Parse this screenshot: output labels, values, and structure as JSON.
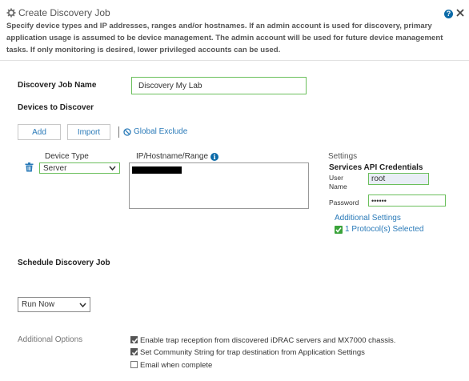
{
  "header": {
    "title": "Create Discovery Job",
    "description": "Specify device types and IP addresses, ranges and/or hostnames. If an admin account is used for discovery, primary application usage is assumed to be device management. The admin account will be used for future device management tasks. If only monitoring is desired, lower privileged accounts can be used.",
    "help_icon": "question-circle-icon",
    "help_label": "?",
    "close_icon": "close-icon"
  },
  "job": {
    "name_label": "Discovery Job Name",
    "name_value": "Discovery My Lab"
  },
  "devices": {
    "section_title": "Devices to Discover",
    "add_label": "Add",
    "import_label": "Import",
    "global_exclude_label": "Global Exclude",
    "device_type_label": "Device Type",
    "device_type_value": "Server",
    "ip_label": "IP/Hostname/Range",
    "info_glyph": "i",
    "settings_label": "Settings",
    "credentials_title": "Services API Credentials",
    "user_name_label_1": "User",
    "user_name_label_2": "Name",
    "user_name_value": "root",
    "password_label": "Password",
    "password_value": "••••••",
    "additional_settings_label": "Additional Settings",
    "protocols_label": "1 Protocol(s) Selected"
  },
  "schedule": {
    "section_title": "Schedule Discovery Job",
    "run_value": "Run Now"
  },
  "options": {
    "label": "Additional Options",
    "items": [
      {
        "label": "Enable trap reception from discovered iDRAC servers and MX7000 chassis.",
        "checked": true
      },
      {
        "label": "Set Community String for trap destination from Application Settings",
        "checked": true
      },
      {
        "label": "Email when complete",
        "checked": false
      }
    ]
  },
  "colors": {
    "accent": "#2a7ab8",
    "valid_border": "#6bbf5c",
    "help_blue": "#0b6aa8"
  }
}
